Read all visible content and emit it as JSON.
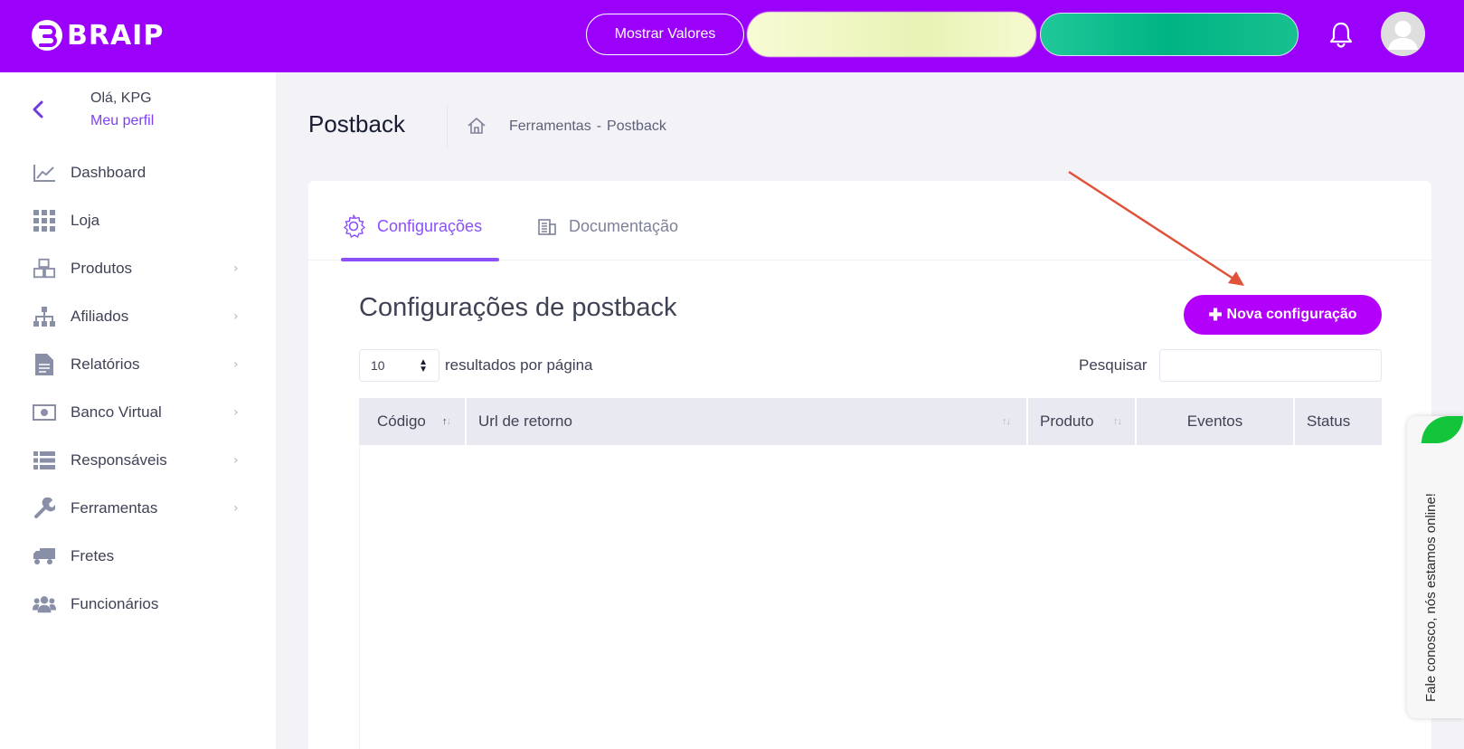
{
  "app": {
    "brand": "BRAIP",
    "accent_color": "#9b00fb",
    "primary_button_color": "#b300fb"
  },
  "topbar": {
    "show_values_label": "Mostrar Valores",
    "notification_icon": "bell-icon",
    "avatar_icon": "user-avatar-icon"
  },
  "sidebar": {
    "greeting": "Olá, KPG",
    "profile_link": "Meu perfil",
    "items": [
      {
        "label": "Dashboard",
        "icon": "chart-line-icon",
        "has_submenu": false
      },
      {
        "label": "Loja",
        "icon": "grid-icon",
        "has_submenu": false
      },
      {
        "label": "Produtos",
        "icon": "boxes-icon",
        "has_submenu": true
      },
      {
        "label": "Afiliados",
        "icon": "sitemap-icon",
        "has_submenu": true
      },
      {
        "label": "Relatórios",
        "icon": "file-icon",
        "has_submenu": true
      },
      {
        "label": "Banco Virtual",
        "icon": "money-bill-icon",
        "has_submenu": true
      },
      {
        "label": "Responsáveis",
        "icon": "list-icon",
        "has_submenu": true
      },
      {
        "label": "Ferramentas",
        "icon": "wrench-icon",
        "has_submenu": true
      },
      {
        "label": "Fretes",
        "icon": "truck-icon",
        "has_submenu": false
      },
      {
        "label": "Funcionários",
        "icon": "users-icon",
        "has_submenu": false
      }
    ]
  },
  "page": {
    "title": "Postback",
    "breadcrumb": [
      "Ferramentas",
      "-",
      "Postback"
    ]
  },
  "tabs": [
    {
      "label": "Configurações",
      "icon": "gear-icon",
      "active": true
    },
    {
      "label": "Documentação",
      "icon": "building-icon",
      "active": false
    }
  ],
  "section": {
    "title": "Configurações de postback",
    "new_button": "Nova configuração",
    "per_page_value": "10",
    "per_page_text": "resultados por página",
    "search_label": "Pesquisar",
    "search_value": ""
  },
  "table": {
    "columns": [
      "Código",
      "Url de retorno",
      "Produto",
      "Eventos",
      "Status"
    ],
    "rows": []
  },
  "chat": {
    "text": "Fale conosco, nós estamos online!"
  }
}
